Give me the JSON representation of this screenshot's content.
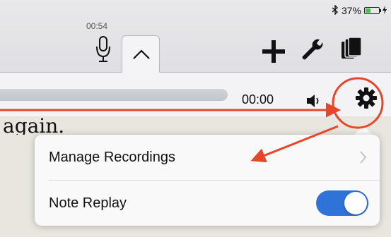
{
  "status_bar": {
    "battery_text": "37%",
    "battery_level": 0.37
  },
  "recorder": {
    "elapsed": "00:54"
  },
  "playback": {
    "time": "00:00"
  },
  "document": {
    "visible_text": "again."
  },
  "settings_menu": {
    "items": [
      {
        "label": "Manage Recordings"
      },
      {
        "label": "Note Replay",
        "toggle_on": true
      }
    ]
  },
  "colors": {
    "annotation": "#e8452b",
    "toggle_on": "#2f73d9"
  }
}
